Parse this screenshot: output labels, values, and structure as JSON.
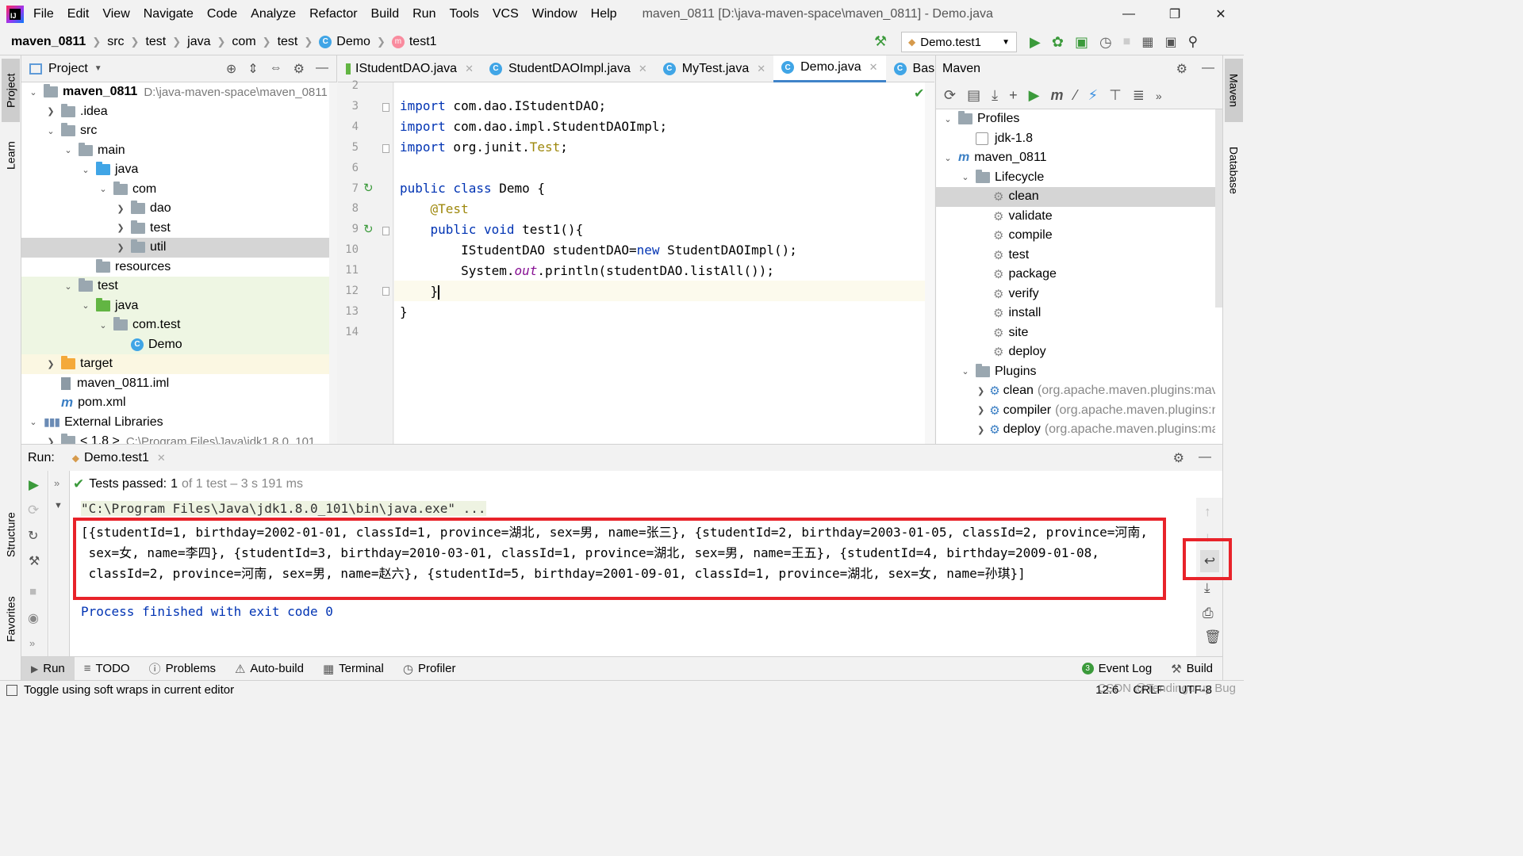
{
  "menubar": {
    "items": [
      "File",
      "Edit",
      "View",
      "Navigate",
      "Code",
      "Analyze",
      "Refactor",
      "Build",
      "Run",
      "Tools",
      "VCS",
      "Window",
      "Help"
    ],
    "title": "maven_0811 [D:\\java-maven-space\\maven_0811] - Demo.java"
  },
  "navbar": {
    "crumbs": [
      "maven_0811",
      "src",
      "test",
      "java",
      "com",
      "test",
      "Demo",
      "test1"
    ],
    "run_config": "Demo.test1"
  },
  "left_strip": {
    "project": "Project",
    "learn": "Learn",
    "structure": "Structure",
    "favorites": "Favorites"
  },
  "right_strip": {
    "maven": "Maven",
    "database": "Database"
  },
  "project": {
    "header": "Project",
    "tree": [
      {
        "label": "maven_0811",
        "extra": "D:\\java-maven-space\\maven_0811",
        "indent": 0,
        "arrow": "v",
        "icon": "gray"
      },
      {
        "label": ".idea",
        "indent": 1,
        "arrow": ">",
        "icon": "gray"
      },
      {
        "label": "src",
        "indent": 1,
        "arrow": "v",
        "icon": "gray"
      },
      {
        "label": "main",
        "indent": 2,
        "arrow": "v",
        "icon": "gray"
      },
      {
        "label": "java",
        "indent": 3,
        "arrow": "v",
        "icon": "blue"
      },
      {
        "label": "com",
        "indent": 4,
        "arrow": "v",
        "icon": "gray"
      },
      {
        "label": "dao",
        "indent": 5,
        "arrow": ">",
        "icon": "gray"
      },
      {
        "label": "test",
        "indent": 5,
        "arrow": ">",
        "icon": "gray"
      },
      {
        "label": "util",
        "indent": 5,
        "arrow": ">",
        "icon": "gray"
      },
      {
        "label": "resources",
        "indent": 3,
        "arrow": "",
        "icon": "gray"
      },
      {
        "label": "test",
        "indent": 2,
        "arrow": "v",
        "icon": "gray"
      },
      {
        "label": "java",
        "indent": 3,
        "arrow": "v",
        "icon": "green"
      },
      {
        "label": "com.test",
        "indent": 4,
        "arrow": "v",
        "icon": "gray"
      },
      {
        "label": "Demo",
        "indent": 5,
        "arrow": "",
        "icon": "class"
      },
      {
        "label": "target",
        "indent": 1,
        "arrow": ">",
        "icon": "orange"
      },
      {
        "label": "maven_0811.iml",
        "indent": 1,
        "arrow": "",
        "icon": "file"
      },
      {
        "label": "pom.xml",
        "indent": 1,
        "arrow": "",
        "icon": "maven"
      },
      {
        "label": "External Libraries",
        "indent": 0,
        "arrow": "v",
        "icon": "lib"
      },
      {
        "label": "< 1.8 >",
        "extra": "C:\\Program Files\\Java\\jdk1.8.0_101",
        "indent": 1,
        "arrow": ">",
        "icon": "gray"
      }
    ]
  },
  "editor": {
    "tabs": [
      {
        "label": "IStudentDAO.java",
        "active": false
      },
      {
        "label": "StudentDAOImpl.java",
        "active": false
      },
      {
        "label": "MyTest.java",
        "active": false
      },
      {
        "label": "Demo.java",
        "active": true
      },
      {
        "label": "Bas",
        "active": false
      }
    ],
    "line_numbers": [
      "2",
      "3",
      "4",
      "5",
      "6",
      "7",
      "8",
      "9",
      "10",
      "11",
      "12",
      "13",
      "14"
    ],
    "code": {
      "l3a": "import",
      "l3b": " com.dao.IStudentDAO;",
      "l4a": "import",
      "l4b": " com.dao.impl.StudentDAOImpl;",
      "l5a": "import",
      "l5b": " org.junit.",
      "l5c": "Test",
      "l5d": ";",
      "l7a": "public class",
      "l7b": " Demo {",
      "l8": "    @Test",
      "l9a": "    public void",
      "l9b": " test1(){",
      "l10a": "        IStudentDAO studentDAO=",
      "l10b": "new",
      "l10c": " StudentDAOImpl();",
      "l11a": "        System.",
      "l11b": "out",
      "l11c": ".println(studentDAO.listAll());",
      "l12": "    }",
      "l13": "}"
    }
  },
  "maven": {
    "header": "Maven",
    "tree": [
      {
        "label": "Profiles",
        "indent": 0,
        "arrow": "v",
        "kind": "folder"
      },
      {
        "label": "jdk-1.8",
        "indent": 1,
        "arrow": "",
        "kind": "check"
      },
      {
        "label": "maven_0811",
        "indent": 0,
        "arrow": "v",
        "kind": "maven"
      },
      {
        "label": "Lifecycle",
        "indent": 1,
        "arrow": "v",
        "kind": "folder"
      },
      {
        "label": "clean",
        "indent": 2,
        "arrow": "",
        "kind": "gear",
        "selected": true
      },
      {
        "label": "validate",
        "indent": 2,
        "arrow": "",
        "kind": "gear"
      },
      {
        "label": "compile",
        "indent": 2,
        "arrow": "",
        "kind": "gear"
      },
      {
        "label": "test",
        "indent": 2,
        "arrow": "",
        "kind": "gear"
      },
      {
        "label": "package",
        "indent": 2,
        "arrow": "",
        "kind": "gear"
      },
      {
        "label": "verify",
        "indent": 2,
        "arrow": "",
        "kind": "gear"
      },
      {
        "label": "install",
        "indent": 2,
        "arrow": "",
        "kind": "gear"
      },
      {
        "label": "site",
        "indent": 2,
        "arrow": "",
        "kind": "gear"
      },
      {
        "label": "deploy",
        "indent": 2,
        "arrow": "",
        "kind": "gear"
      },
      {
        "label": "Plugins",
        "indent": 1,
        "arrow": "v",
        "kind": "folder"
      },
      {
        "label": "clean",
        "extra": "(org.apache.maven.plugins:mave",
        "indent": 2,
        "arrow": ">",
        "kind": "plugin"
      },
      {
        "label": "compiler",
        "extra": "(org.apache.maven.plugins:n",
        "indent": 2,
        "arrow": ">",
        "kind": "plugin"
      },
      {
        "label": "deploy",
        "extra": "(org.apache.maven.plugins:ma",
        "indent": 2,
        "arrow": ">",
        "kind": "plugin"
      }
    ]
  },
  "run": {
    "label": "Run:",
    "tab": "Demo.test1",
    "tests_passed": "Tests passed:",
    "count": "1",
    "of_text": "of 1 test – 3 s 191 ms",
    "cmd": "\"C:\\Program Files\\Java\\jdk1.8.0_101\\bin\\java.exe\" ...",
    "out1": "[{studentId=1, birthday=2002-01-01, classId=1, province=湖北, sex=男, name=张三}, {studentId=2, birthday=2003-01-05, classId=2, province=河南,",
    "out2": " sex=女, name=李四}, {studentId=3, birthday=2010-03-01, classId=1, province=湖北, sex=男, name=王五}, {studentId=4, birthday=2009-01-08,",
    "out3": " classId=2, province=河南, sex=男, name=赵六}, {studentId=5, birthday=2001-09-01, classId=1, province=湖北, sex=女, name=孙琪}]",
    "exit": "Process finished with exit code 0"
  },
  "toolwindows": {
    "run": "Run",
    "todo": "TODO",
    "problems": "Problems",
    "autobuild": "Auto-build",
    "terminal": "Terminal",
    "profiler": "Profiler",
    "eventlog": "Event Log",
    "build": "Build"
  },
  "status": {
    "message": "Toggle using soft wraps in current editor",
    "position": "12:6",
    "line_sep": "CRLF",
    "encoding": "UTF-8",
    "watermark": "CSDN @Tendinguruy Bug"
  },
  "colors": {
    "highlight_red": "#e8232a",
    "accent_blue": "#4083c9",
    "run_green": "#3b9a3b"
  }
}
